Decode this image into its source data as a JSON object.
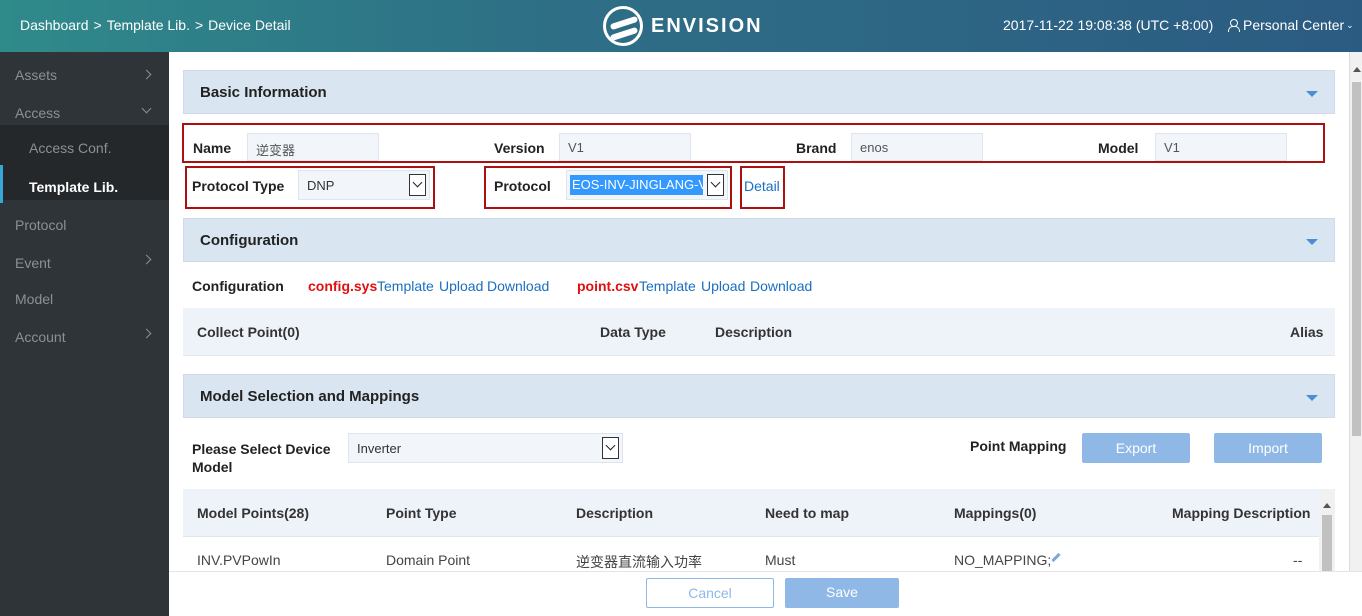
{
  "header": {
    "breadcrumb": [
      "Dashboard",
      "Template Lib.",
      "Device Detail"
    ],
    "breadcrumb_sep": ">",
    "brand": "ENVISION",
    "datetime": "2017-11-22 19:08:38 (UTC +8:00)",
    "personal_center": "Personal Center"
  },
  "sidebar": {
    "items": [
      {
        "label": "Assets",
        "expandable": true
      },
      {
        "label": "Access",
        "expandable": true,
        "expanded": true
      },
      {
        "label": "Protocol",
        "expandable": false
      },
      {
        "label": "Event",
        "expandable": true
      },
      {
        "label": "Model",
        "expandable": false
      },
      {
        "label": "Account",
        "expandable": true
      }
    ],
    "access_sub": [
      {
        "label": "Access Conf.",
        "active": false
      },
      {
        "label": "Template Lib.",
        "active": true
      }
    ]
  },
  "basic": {
    "title": "Basic Information",
    "name_label": "Name",
    "name_value": "逆变器",
    "version_label": "Version",
    "version_value": "V1",
    "brand_label": "Brand",
    "brand_value": "enos",
    "model_label": "Model",
    "model_value": "V1",
    "protocol_type_label": "Protocol Type",
    "protocol_type_value": "DNP",
    "protocol_label": "Protocol",
    "protocol_value": "EOS-INV-JINGLANG-V",
    "detail_link": "Detail"
  },
  "configuration": {
    "title": "Configuration",
    "label": "Configuration",
    "files": [
      {
        "name": "config.sys",
        "actions": [
          "Template",
          "Upload",
          "Download"
        ]
      },
      {
        "name": "point.csv",
        "actions": [
          "Template",
          "Upload",
          "Download"
        ]
      }
    ],
    "table_headers": [
      "Collect Point(0)",
      "Data Type",
      "Description",
      "Alias"
    ]
  },
  "model": {
    "title": "Model Selection and Mappings",
    "select_label": "Please Select Device Model",
    "select_value": "Inverter",
    "point_mapping_label": "Point Mapping",
    "export_label": "Export",
    "import_label": "Import",
    "table_headers": [
      "Model Points(28)",
      "Point Type",
      "Description",
      "Need to map",
      "Mappings(0)",
      "Mapping Description"
    ],
    "rows": [
      {
        "point": "INV.PVPowIn",
        "type": "Domain Point",
        "description": "逆变器直流输入功率",
        "need": "Must",
        "mapping": "NO_MAPPING;",
        "mapping_desc": "--"
      }
    ]
  },
  "footer": {
    "cancel_label": "Cancel",
    "save_label": "Save"
  },
  "colors": {
    "accent": "#8fb8e6",
    "link": "#1a6fc0",
    "file_red": "#e01010",
    "highlight_box": "#a11111",
    "sidebar_bg": "#2f3438"
  }
}
